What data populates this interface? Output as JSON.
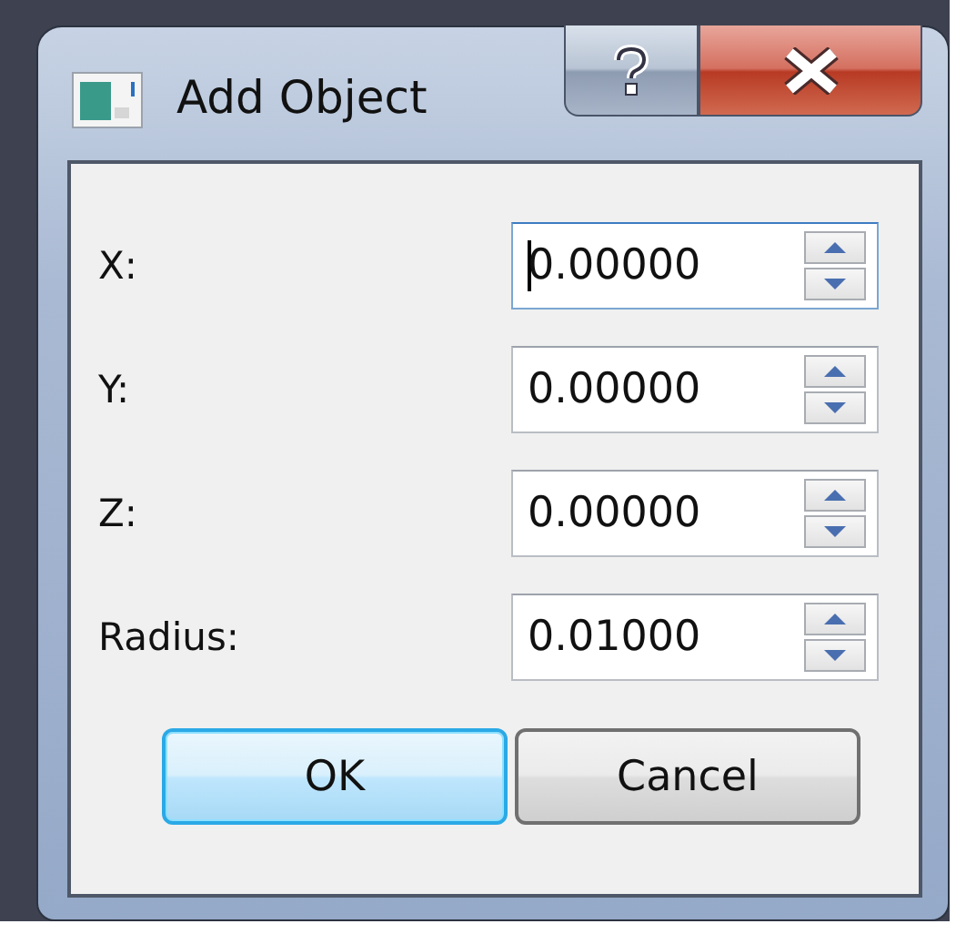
{
  "window": {
    "title": "Add Object"
  },
  "fields": [
    {
      "label": "X:",
      "value": "0.00000",
      "focused": true
    },
    {
      "label": "Y:",
      "value": "0.00000",
      "focused": false
    },
    {
      "label": "Z:",
      "value": "0.00000",
      "focused": false
    },
    {
      "label": "Radius:",
      "value": "0.01000",
      "focused": false
    }
  ],
  "buttons": [
    {
      "label": "OK",
      "default": true
    },
    {
      "label": "Cancel",
      "default": false
    }
  ]
}
